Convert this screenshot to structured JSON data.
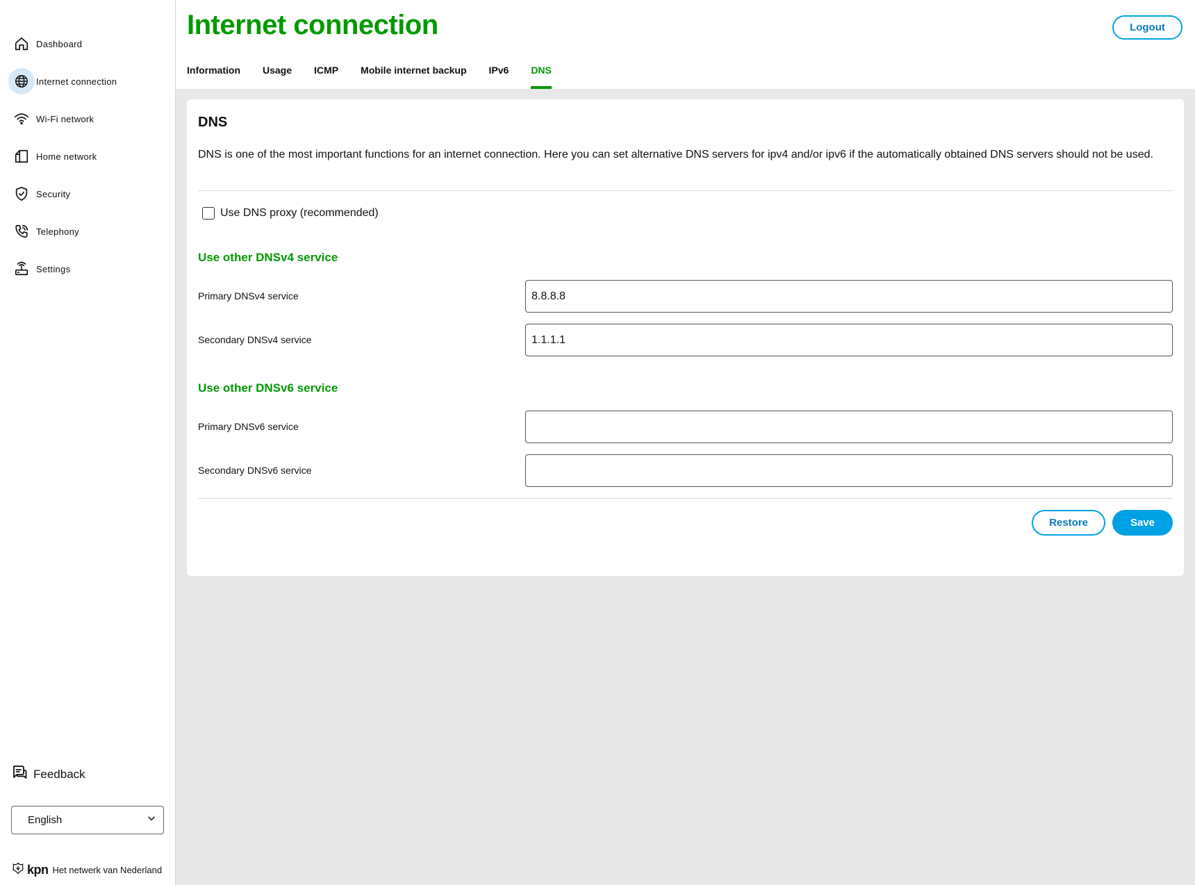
{
  "sidebar": {
    "items": [
      {
        "label": "Dashboard",
        "icon": "home-icon"
      },
      {
        "label": "Internet connection",
        "icon": "globe-icon",
        "active": true
      },
      {
        "label": "Wi-Fi network",
        "icon": "wifi-icon"
      },
      {
        "label": "Home network",
        "icon": "house-icon"
      },
      {
        "label": "Security",
        "icon": "shield-icon"
      },
      {
        "label": "Telephony",
        "icon": "phone-icon"
      },
      {
        "label": "Settings",
        "icon": "router-icon"
      }
    ],
    "feedback_label": "Feedback",
    "language": {
      "selected": "English"
    },
    "brand": {
      "name": "kpn",
      "tagline": "Het netwerk van Nederland"
    }
  },
  "header": {
    "title": "Internet connection",
    "logout_label": "Logout",
    "tabs": [
      {
        "label": "Information"
      },
      {
        "label": "Usage"
      },
      {
        "label": "ICMP"
      },
      {
        "label": "Mobile internet backup"
      },
      {
        "label": "IPv6"
      },
      {
        "label": "DNS",
        "active": true
      }
    ]
  },
  "card": {
    "title": "DNS",
    "description": "DNS is one of the most important functions for an internet connection. Here you can set alternative DNS servers for ipv4 and/or ipv6 if the automatically obtained DNS servers should not be used.",
    "proxy_label": "Use DNS proxy (recommended)",
    "proxy_checked": false,
    "dnsv4": {
      "title": "Use other DNSv4 service",
      "primary_label": "Primary DNSv4 service",
      "primary_value": "8.8.8.8",
      "secondary_label": "Secondary DNSv4 service",
      "secondary_value": "1.1.1.1"
    },
    "dnsv6": {
      "title": "Use other DNSv6 service",
      "primary_label": "Primary DNSv6 service",
      "primary_value": "",
      "secondary_label": "Secondary DNSv6 service",
      "secondary_value": ""
    },
    "restore_label": "Restore",
    "save_label": "Save"
  },
  "colors": {
    "brand_green": "#009900",
    "accent_blue": "#00a1e4",
    "active_icon_bg": "#d7e8f7",
    "page_bg": "#e8e8e8"
  }
}
